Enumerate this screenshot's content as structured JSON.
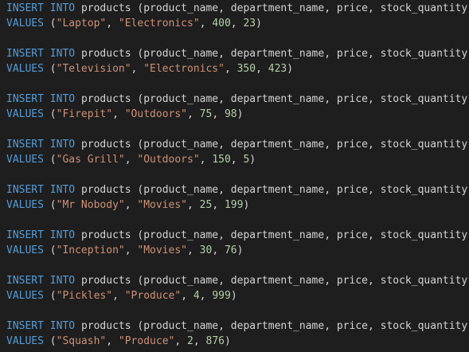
{
  "editor": {
    "statements": [
      {
        "insert_kw": "INSERT",
        "into_kw": "INTO",
        "table": "products",
        "columns": "(product_name, department_name, price, stock_quantity)",
        "values_kw": "VALUES",
        "product": "\"Laptop\"",
        "department": "\"Electronics\"",
        "price": "400",
        "stock": "23"
      },
      {
        "insert_kw": "INSERT",
        "into_kw": "INTO",
        "table": "products",
        "columns": "(product_name, department_name, price, stock_quantity)",
        "values_kw": "VALUES",
        "product": "\"Television\"",
        "department": "\"Electronics\"",
        "price": "350",
        "stock": "423"
      },
      {
        "insert_kw": "INSERT",
        "into_kw": "INTO",
        "table": "products",
        "columns": "(product_name, department_name, price, stock_quantity)",
        "values_kw": "VALUES",
        "product": "\"Firepit\"",
        "department": "\"Outdoors\"",
        "price": "75",
        "stock": "98"
      },
      {
        "insert_kw": "INSERT",
        "into_kw": "INTO",
        "table": "products",
        "columns": "(product_name, department_name, price, stock_quantity)",
        "values_kw": "VALUES",
        "product": "\"Gas Grill\"",
        "department": "\"Outdoors\"",
        "price": "150",
        "stock": "5"
      },
      {
        "insert_kw": "INSERT",
        "into_kw": "INTO",
        "table": "products",
        "columns": "(product_name, department_name, price, stock_quantity)",
        "values_kw": "VALUES",
        "product": "\"Mr Nobody\"",
        "department": "\"Movies\"",
        "price": "25",
        "stock": "199"
      },
      {
        "insert_kw": "INSERT",
        "into_kw": "INTO",
        "table": "products",
        "columns": "(product_name, department_name, price, stock_quantity)",
        "values_kw": "VALUES",
        "product": "\"Inception\"",
        "department": "\"Movies\"",
        "price": "30",
        "stock": "76"
      },
      {
        "insert_kw": "INSERT",
        "into_kw": "INTO",
        "table": "products",
        "columns": "(product_name, department_name, price, stock_quantity)",
        "values_kw": "VALUES",
        "product": "\"Pickles\"",
        "department": "\"Produce\"",
        "price": "4",
        "stock": "999"
      },
      {
        "insert_kw": "INSERT",
        "into_kw": "INTO",
        "table": "products",
        "columns": "(product_name, department_name, price, stock_quantity)",
        "values_kw": "VALUES",
        "product": "\"Squash\"",
        "department": "\"Produce\"",
        "price": "2",
        "stock": "876"
      }
    ]
  },
  "colors": {
    "background": "#1e1e1e",
    "keyword": "#569cd6",
    "text": "#d4d4d4",
    "string": "#ce9178",
    "number": "#b5cea8"
  }
}
